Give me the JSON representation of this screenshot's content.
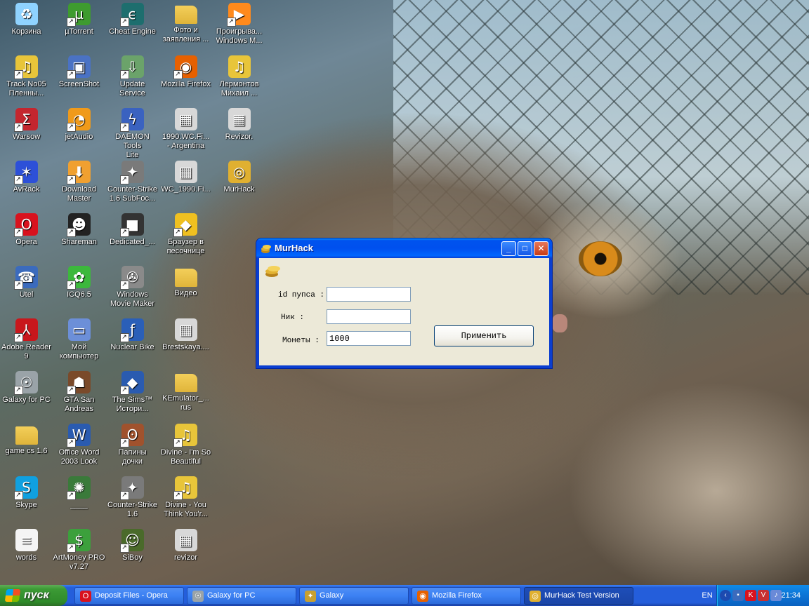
{
  "desktop": {
    "icons": [
      {
        "label": "Корзина",
        "icon": "recycle-bin-icon",
        "color": "#8fd3ff",
        "glyph": "♻"
      },
      {
        "label": "µTorrent",
        "icon": "utorrent-icon",
        "color": "#3e9b2f",
        "glyph": "µ"
      },
      {
        "label": "Cheat Engine",
        "icon": "cheat-engine-icon",
        "color": "#1d6e6e",
        "glyph": "ϵ"
      },
      {
        "label": "Фото и\nзаявления ...",
        "icon": "folder-icon",
        "color": "#f3cf5a",
        "glyph": ""
      },
      {
        "label": "Проигрыва...\nWindows M...",
        "icon": "media-player-icon",
        "color": "#ff8a1c",
        "glyph": "▶"
      },
      {
        "label": "Track No05\nПленны...",
        "icon": "audio-cd-icon",
        "color": "#e8c53a",
        "glyph": "♫"
      },
      {
        "label": "ScreenShot",
        "icon": "screenshot-icon",
        "color": "#4a72c4",
        "glyph": "▣"
      },
      {
        "label": "Update\nService",
        "icon": "update-service-icon",
        "color": "#6ba36a",
        "glyph": "⇩"
      },
      {
        "label": "Mozilla Firefox",
        "icon": "firefox-icon",
        "color": "#e66000",
        "glyph": "◉"
      },
      {
        "label": "Лермонтов\nМихаил ...",
        "icon": "audio-cd-icon",
        "color": "#e8c53a",
        "glyph": "♫"
      },
      {
        "label": "Warsow",
        "icon": "warsow-icon",
        "color": "#c4262e",
        "glyph": "Σ"
      },
      {
        "label": "jetAudio",
        "icon": "jetaudio-icon",
        "color": "#f09a1a",
        "glyph": "◔"
      },
      {
        "label": "DAEMON Tools\nLite",
        "icon": "daemon-tools-icon",
        "color": "#3a62c0",
        "glyph": "ϟ"
      },
      {
        "label": "1990.WC.Fi...\n- Argentina",
        "icon": "avi-file-icon",
        "color": "#d8d8d8",
        "glyph": "▦"
      },
      {
        "label": "Revizor.",
        "icon": "avi-file-icon",
        "color": "#d8d8d8",
        "glyph": "▦"
      },
      {
        "label": "AvRack",
        "icon": "avrack-icon",
        "color": "#2d50d8",
        "glyph": "✶"
      },
      {
        "label": "Download\nMaster",
        "icon": "download-master-icon",
        "color": "#f0a030",
        "glyph": "⬇"
      },
      {
        "label": "Counter-Strike\n1.6 SubFoc...",
        "icon": "counter-strike-icon",
        "color": "#7a7a7a",
        "glyph": "✦"
      },
      {
        "label": "WC_1990.Fi...",
        "icon": "avi-file-icon",
        "color": "#d8d8d8",
        "glyph": "▦"
      },
      {
        "label": "MurHack",
        "icon": "coins-icon",
        "color": "#e0b030",
        "glyph": "◎"
      },
      {
        "label": "Opera",
        "icon": "opera-icon",
        "color": "#d8121e",
        "glyph": "O"
      },
      {
        "label": "Shareman",
        "icon": "shareman-icon",
        "color": "#222222",
        "glyph": "☻"
      },
      {
        "label": "Dedicated_...",
        "icon": "dedicated-server-icon",
        "color": "#333333",
        "glyph": "■"
      },
      {
        "label": "Браузер в\nпесочнице",
        "icon": "sandbox-browser-icon",
        "color": "#f0c020",
        "glyph": "◆"
      },
      {
        "label": "Utel",
        "icon": "utel-icon",
        "color": "#3b6bbd",
        "glyph": "☎"
      },
      {
        "label": "ICQ6.5",
        "icon": "icq-icon",
        "color": "#3cb83c",
        "glyph": "✿"
      },
      {
        "label": "Windows\nMovie Maker",
        "icon": "movie-maker-icon",
        "color": "#8a8a8a",
        "glyph": "✇"
      },
      {
        "label": "Видео",
        "icon": "folder-icon",
        "color": "#f3cf5a",
        "glyph": ""
      },
      {
        "label": "Adobe Reader\n9",
        "icon": "adobe-reader-icon",
        "color": "#c8171c",
        "glyph": "⅄"
      },
      {
        "label": "Мой\nкомпьютер",
        "icon": "my-computer-icon",
        "color": "#6c8fd8",
        "glyph": "▭"
      },
      {
        "label": "Nuclear Bike",
        "icon": "flash-icon",
        "color": "#2a5fb8",
        "glyph": "ƒ"
      },
      {
        "label": "Brestskaya....",
        "icon": "avi-file-icon",
        "color": "#d8d8d8",
        "glyph": "▦"
      },
      {
        "label": "Galaxy for PC",
        "icon": "alien-icon",
        "color": "#9aa3a8",
        "glyph": "☉"
      },
      {
        "label": "GTA San\nAndreas",
        "icon": "gta-icon",
        "color": "#7a4a2a",
        "glyph": "☗"
      },
      {
        "label": "The Sims™\nИстори...",
        "icon": "sims-icon",
        "color": "#2a5bb0",
        "glyph": "◆"
      },
      {
        "label": "KEmulator_...\nrus",
        "icon": "folder-icon",
        "color": "#f3cf5a",
        "glyph": ""
      },
      {
        "label": "game cs 1.6",
        "icon": "folder-icon",
        "color": "#f3cf5a",
        "glyph": ""
      },
      {
        "label": "Office Word\n2003 Look",
        "icon": "word-document-icon",
        "color": "#2a5bb0",
        "glyph": "W"
      },
      {
        "label": "Папины\nдочки",
        "icon": "teddy-bear-icon",
        "color": "#a0522d",
        "glyph": "ʘ"
      },
      {
        "label": "Divine - I'm So\nBeautiful",
        "icon": "audio-cd-icon",
        "color": "#e8c53a",
        "glyph": "♫"
      },
      {
        "label": "Skype",
        "icon": "skype-icon",
        "color": "#10a0e0",
        "glyph": "S"
      },
      {
        "label": "____",
        "icon": "app-icon",
        "color": "#3a7a3a",
        "glyph": "✺"
      },
      {
        "label": "Counter-Strike\n1.6",
        "icon": "counter-strike-icon",
        "color": "#7a7a7a",
        "glyph": "✦"
      },
      {
        "label": "Divine - You\nThink You'r...",
        "icon": "audio-cd-icon",
        "color": "#e8c53a",
        "glyph": "♫"
      },
      {
        "label": "words",
        "icon": "text-document-icon",
        "color": "#f4f4f4",
        "glyph": "≡"
      },
      {
        "label": "ArtMoney PRO\nv7.27",
        "icon": "artmoney-icon",
        "color": "#3ca03c",
        "glyph": "$"
      },
      {
        "label": "SiBoy",
        "icon": "siboy-icon",
        "color": "#4a6a2a",
        "glyph": "☺"
      },
      {
        "label": "revizor",
        "icon": "avi-file-icon",
        "color": "#d8d8d8",
        "glyph": "▦"
      }
    ]
  },
  "window": {
    "title": "MurHack",
    "form": {
      "id_label": "id пупса :",
      "nick_label": "Ник      :",
      "coins_label": "Монеты :",
      "id_value": "",
      "nick_value": "",
      "coins_value": "1000",
      "apply_label": "Применить"
    }
  },
  "taskbar": {
    "start_label": "пуск",
    "tasks": [
      {
        "label": "Deposit Files - Opera",
        "icon": "opera-icon",
        "color": "#d8121e",
        "glyph": "O",
        "active": false
      },
      {
        "label": "Galaxy for PC",
        "icon": "alien-icon",
        "color": "#9aa3a8",
        "glyph": "☉",
        "active": false
      },
      {
        "label": "Galaxy",
        "icon": "galaxy-icon",
        "color": "#c8a030",
        "glyph": "✦",
        "active": false
      },
      {
        "label": "Mozilla Firefox",
        "icon": "firefox-icon",
        "color": "#e66000",
        "glyph": "◉",
        "active": false
      },
      {
        "label": "MurHack Test Version",
        "icon": "coins-icon",
        "color": "#e0b030",
        "glyph": "◎",
        "active": true
      }
    ],
    "language": "EN",
    "clock": "21:34"
  },
  "colors": {
    "xp_blue": "#245edb",
    "start_green": "#3c9a35",
    "window_face": "#ece9d8"
  }
}
